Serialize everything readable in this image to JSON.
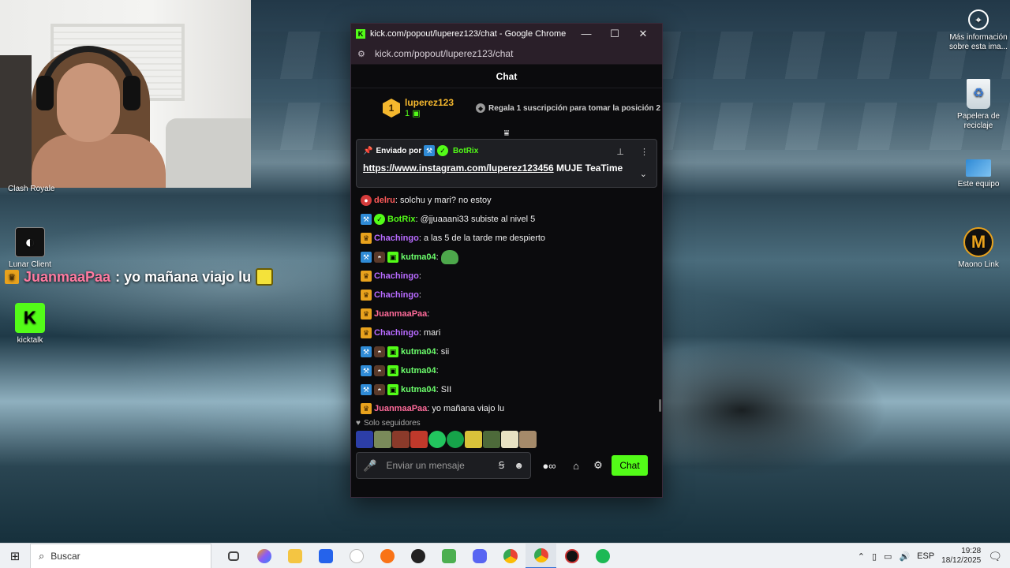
{
  "desktop": {
    "icons": {
      "clash": "Clash Royale",
      "lunar": "Lunar Client",
      "kicktalk": "kicktalk",
      "info": "Más información sobre esta ima...",
      "recycle": "Papelera de reciclaje",
      "thispc": "Este equipo",
      "maono": "Maono Link"
    },
    "overlay": {
      "user": "JuanmaaPaa",
      "text": " : yo mañana viajo lu"
    }
  },
  "browser": {
    "title": "kick.com/popout/luperez123/chat - Google Chrome",
    "url": "kick.com/popout/luperez123/chat",
    "favicon": "K"
  },
  "chat": {
    "header": "Chat",
    "leader": {
      "rank": "1",
      "name": "luperez123",
      "count": "1",
      "gift_text": "Regala 1 suscripción para tomar la posición 2"
    },
    "pinned": {
      "sent_by": "Enviado por",
      "author": "BotRix",
      "link": "https://www.instagram.com/luperez123456",
      "suffix": " MUJE TeaTime"
    },
    "messages": [
      {
        "user": "delru",
        "text": ": solchu y mari? no estoy"
      },
      {
        "user": "BotRix",
        "text": ": @jjuaaani33 subiste al nivel 5"
      },
      {
        "user": "Chachingo",
        "text": ": a las 5 de la tarde me despierto"
      },
      {
        "user": "kutma04",
        "text": ":"
      },
      {
        "user": "Chachingo",
        "text": ":"
      },
      {
        "user": "Chachingo",
        "text": ":"
      },
      {
        "user": "JuanmaaPaa",
        "text": ":"
      },
      {
        "user": "Chachingo",
        "text": ": mari"
      },
      {
        "user": "kutma04",
        "text": ": sii"
      },
      {
        "user": "kutma04",
        "text": ":"
      },
      {
        "user": "kutma04",
        "text": ": SII"
      },
      {
        "user": "JuanmaaPaa",
        "text": ": yo mañana viajo lu"
      }
    ],
    "followers_only": "Solo seguidores",
    "input_placeholder": "Enviar un mensaje",
    "send_label": "Chat"
  },
  "taskbar": {
    "search": "Buscar",
    "lang": "ESP",
    "time": "19:28",
    "date": "18/12/2025"
  },
  "colors": {
    "kick_green": "#53fc18",
    "gold": "#f5b82e",
    "purple": "#b86bff",
    "pink": "#ff6b9a"
  }
}
